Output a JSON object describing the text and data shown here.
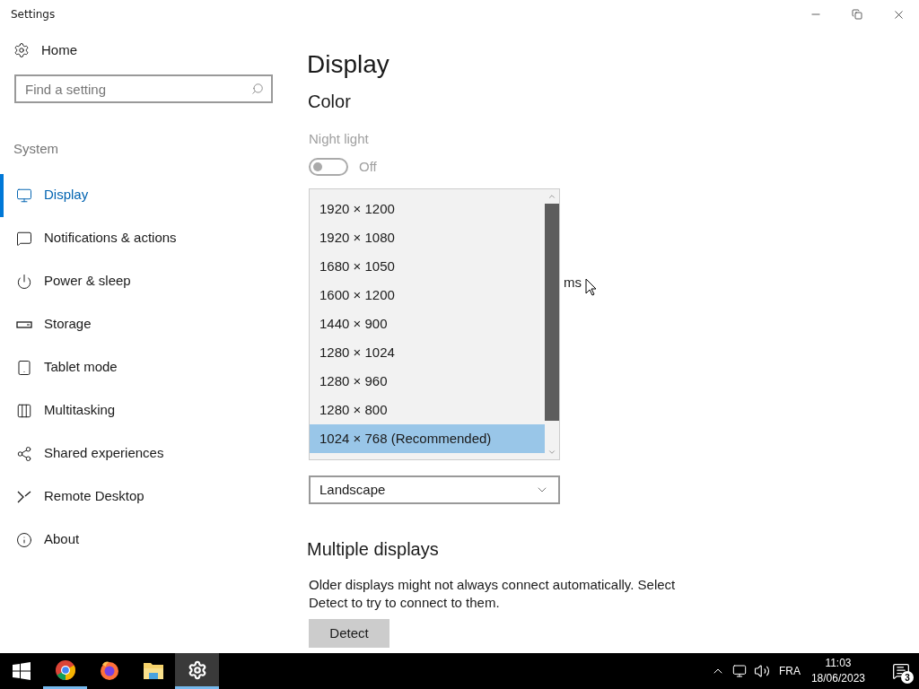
{
  "window": {
    "title": "Settings"
  },
  "sidebar": {
    "home": "Home",
    "search": {
      "placeholder": "Find a setting"
    },
    "section": "System",
    "items": [
      {
        "label": "Display",
        "selected": true
      },
      {
        "label": "Notifications & actions",
        "selected": false
      },
      {
        "label": "Power & sleep",
        "selected": false
      },
      {
        "label": "Storage",
        "selected": false
      },
      {
        "label": "Tablet mode",
        "selected": false
      },
      {
        "label": "Multitasking",
        "selected": false
      },
      {
        "label": "Shared experiences",
        "selected": false
      },
      {
        "label": "Remote Desktop",
        "selected": false
      },
      {
        "label": "About",
        "selected": false
      }
    ]
  },
  "main": {
    "title": "Display",
    "color_heading": "Color",
    "night_light": {
      "label": "Night light",
      "on": false,
      "state": "Off"
    },
    "partial_text": "ms",
    "resolution_list": [
      {
        "label": "1920 × 1200",
        "selected": false
      },
      {
        "label": "1920 × 1080",
        "selected": false
      },
      {
        "label": "1680 × 1050",
        "selected": false
      },
      {
        "label": "1600 × 1200",
        "selected": false
      },
      {
        "label": "1440 × 900",
        "selected": false
      },
      {
        "label": "1280 × 1024",
        "selected": false
      },
      {
        "label": "1280 × 960",
        "selected": false
      },
      {
        "label": "1280 × 800",
        "selected": false
      },
      {
        "label": "1024 × 768 (Recommended)",
        "selected": true
      }
    ],
    "orientation": {
      "value": "Landscape"
    },
    "multiple_displays": {
      "heading": "Multiple displays",
      "text": "Older displays might not always connect automatically. Select Detect to try to connect to them.",
      "button": "Detect"
    }
  },
  "taskbar": {
    "apps": [
      {
        "kind": "chrome",
        "running": true,
        "active": false
      },
      {
        "kind": "firefox",
        "running": false,
        "active": false
      },
      {
        "kind": "explorer",
        "running": false,
        "active": false
      },
      {
        "kind": "settings",
        "running": true,
        "active": true
      }
    ],
    "language": "FRA",
    "time": "11:03",
    "date": "18/06/2023",
    "notifications": "3"
  }
}
